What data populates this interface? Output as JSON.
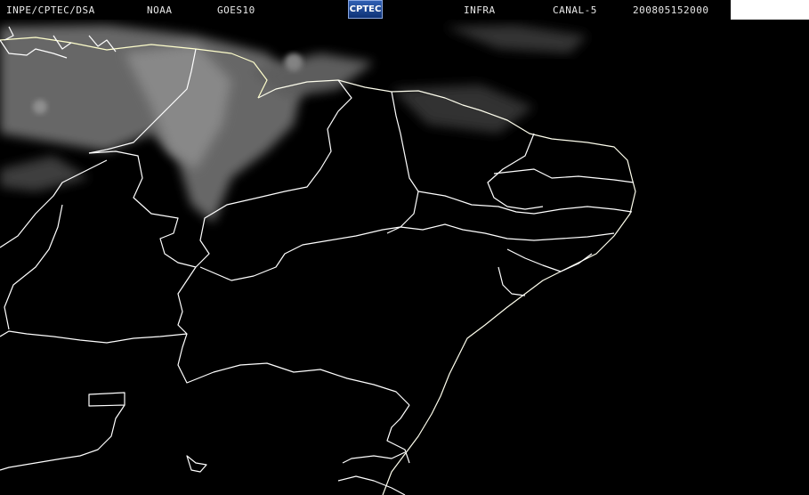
{
  "header": {
    "institution": "INPE/CPTEC/DSA",
    "agency": "NOAA",
    "satellite": "GOES10",
    "logo_text": "CPTEC",
    "product": "INFRA",
    "channel": "CANAL-5",
    "timestamp": "200805152000"
  },
  "colors": {
    "background": "#000000",
    "borders": "#ffffff",
    "coast_highlight": "#ffffcc",
    "clouds": "#9a9a9a",
    "logo": "#1f4a9a"
  },
  "icons": {
    "logo": "cptec-logo"
  }
}
